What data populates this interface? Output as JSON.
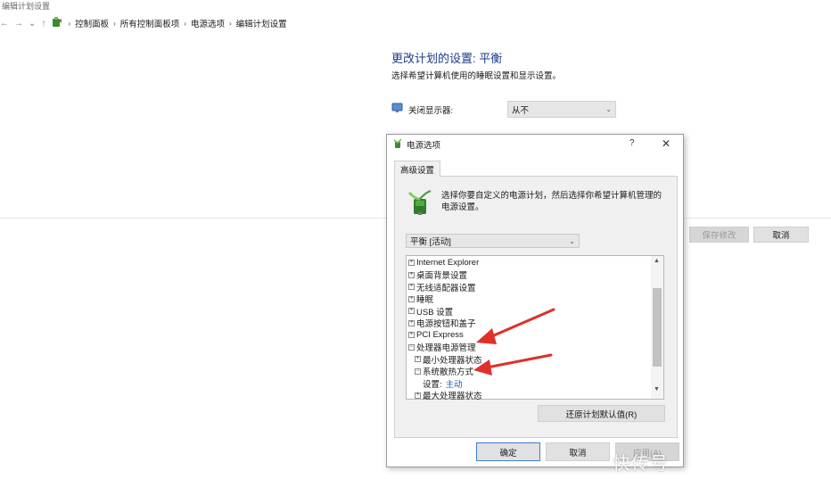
{
  "window": {
    "title": "编辑计划设置"
  },
  "nav": {
    "back": "←",
    "forward": "→",
    "recent": "⌄",
    "up": "↑",
    "breadcrumb": [
      "控制面板",
      "所有控制面板项",
      "电源选项",
      "编辑计划设置"
    ],
    "separator": "›"
  },
  "page": {
    "heading": "更改计划的设置: 平衡",
    "subheading": "选择希望计算机使用的睡眠设置和显示设置。",
    "display_off_label": "关闭显示器:",
    "display_off_value": "从不",
    "save_button": "保存修改",
    "cancel_button": "取消"
  },
  "dialog": {
    "title": "电源选项",
    "help": "?",
    "close": "✕",
    "tab": "高级设置",
    "intro": "选择你要自定义的电源计划，然后选择你希望计算机管理的电源设置。",
    "plan": "平衡 [活动]",
    "tree": [
      {
        "label": "Internet Explorer",
        "toggle": "+",
        "level": 1
      },
      {
        "label": "桌面背景设置",
        "toggle": "+",
        "level": 1
      },
      {
        "label": "无线适配器设置",
        "toggle": "+",
        "level": 1
      },
      {
        "label": "睡眠",
        "toggle": "+",
        "level": 1
      },
      {
        "label": "USB 设置",
        "toggle": "+",
        "level": 1
      },
      {
        "label": "电源按钮和盖子",
        "toggle": "+",
        "level": 1
      },
      {
        "label": "PCI Express",
        "toggle": "+",
        "level": 1
      },
      {
        "label": "处理器电源管理",
        "toggle": "−",
        "level": 1
      },
      {
        "label": "最小处理器状态",
        "toggle": "+",
        "level": 2
      },
      {
        "label": "系统散热方式",
        "toggle": "−",
        "level": 2
      },
      {
        "label": "设置:",
        "value": "主动",
        "level": 3
      },
      {
        "label": "最大处理器状态",
        "toggle": "+",
        "level": 2
      }
    ],
    "restore_button": "还原计划默认值(R)",
    "ok_button": "确定",
    "cancel_button": "取消",
    "apply_button": "应用(A)"
  },
  "watermark": "快传号",
  "colors": {
    "heading": "#1e3a8a",
    "link": "#1a5fb4",
    "arrow": "#e0302a"
  }
}
